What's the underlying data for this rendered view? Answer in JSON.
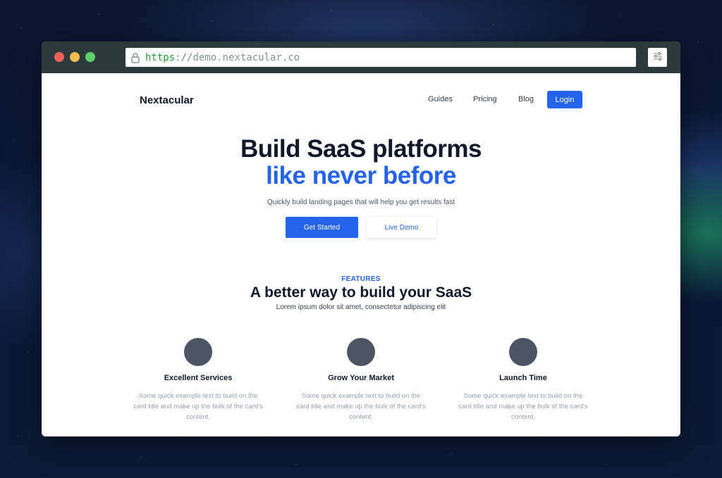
{
  "browser": {
    "url_scheme": "https",
    "url_separator": "://",
    "url_host": "demo.nextacular.co",
    "menu_icon": "sliders-icon"
  },
  "navbar": {
    "brand": "Nextacular",
    "links": [
      "Guides",
      "Pricing",
      "Blog"
    ],
    "login_label": "Login"
  },
  "hero": {
    "title_line1": "Build SaaS platforms",
    "title_line2": "like never before",
    "subtitle": "Quickly build landing pages that will help you get results fast",
    "primary_cta": "Get Started",
    "secondary_cta": "Live Demo"
  },
  "features": {
    "label": "FEATURES",
    "title": "A better way to build your SaaS",
    "subtitle": "Lorem ipsum dolor sit amet, consectetur adipiscing elit",
    "items": [
      {
        "title": "Excellent Services",
        "text": "Some quick example text to build on the card title and make up the bulk of the card's content."
      },
      {
        "title": "Grow Your Market",
        "text": "Some quick example text to build on the card title and make up the bulk of the card's content."
      },
      {
        "title": "Launch Time",
        "text": "Some quick example text to build on the card title and make up the bulk of the card's content."
      }
    ]
  },
  "colors": {
    "accent": "#2563eb",
    "heading": "#111827",
    "feature_icon": "#4b5563"
  }
}
